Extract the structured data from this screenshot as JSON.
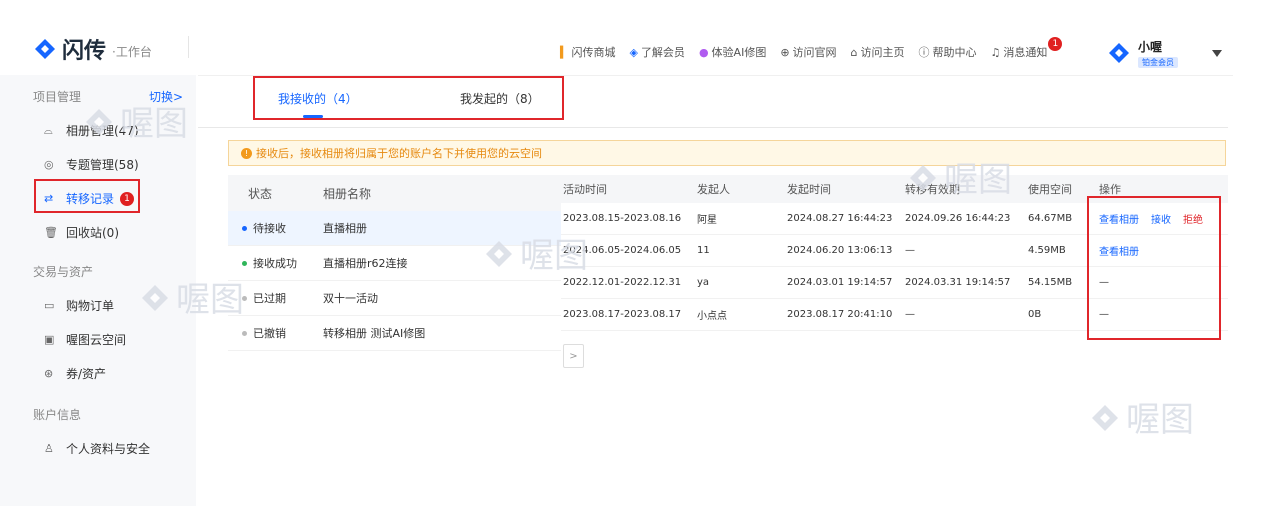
{
  "header": {
    "logo_name": "闪传",
    "logo_sub": "·工作台",
    "nav": [
      {
        "icon": "shop-icon",
        "label": "闪传商城"
      },
      {
        "icon": "vip-icon",
        "label": "了解会员"
      },
      {
        "icon": "ai-icon",
        "label": "体验AI修图"
      },
      {
        "icon": "globe-icon",
        "label": "访问官网"
      },
      {
        "icon": "home-icon",
        "label": "访问主页"
      },
      {
        "icon": "help-icon",
        "label": "帮助中心"
      },
      {
        "icon": "bell-icon",
        "label": "消息通知"
      }
    ],
    "notify_badge": "1",
    "user_name": "小喔",
    "user_tag": "铂金会员"
  },
  "sidebar": {
    "group1": "项目管理",
    "switch": "切换>",
    "items1": [
      {
        "icon": "album-icon",
        "label": "相册管理(47)"
      },
      {
        "icon": "topic-icon",
        "label": "专题管理(58)"
      },
      {
        "icon": "transfer-icon",
        "label": "转移记录",
        "badge": "1"
      },
      {
        "icon": "trash-icon",
        "label": "回收站(0)"
      }
    ],
    "group2": "交易与资产",
    "items2": [
      {
        "icon": "order-icon",
        "label": "购物订单"
      },
      {
        "icon": "cloud-icon",
        "label": "喔图云空间"
      },
      {
        "icon": "coupon-icon",
        "label": "券/资产"
      }
    ],
    "group3": "账户信息",
    "items3": [
      {
        "icon": "user-icon",
        "label": "个人资料与安全"
      }
    ]
  },
  "tabs": {
    "received": "我接收的（4）",
    "sent": "我发起的（8）"
  },
  "notice": "接收后，接收相册将归属于您的账户名下并使用您的云空间",
  "left_table": {
    "headers": [
      "状态",
      "相册名称"
    ],
    "rows": [
      {
        "status": "待接收",
        "name": "直播相册",
        "color": "#1666ff"
      },
      {
        "status": "接收成功",
        "name": "直播相册r62连接",
        "color": "#2fb55a"
      },
      {
        "status": "已过期",
        "name": "双十一活动",
        "color": "#bbbbbb"
      },
      {
        "status": "已撤销",
        "name": "转移相册 测试AI修图",
        "color": "#bbbbbb"
      }
    ]
  },
  "right_table": {
    "headers": [
      "活动时间",
      "发起人",
      "发起时间",
      "转移有效期",
      "使用空间",
      "操作"
    ],
    "rows": [
      {
        "time": "2023.08.15-2023.08.16",
        "by": "阿星",
        "at": "2024.08.27 16:44:23",
        "valid": "2024.09.26 16:44:23",
        "space": "64.67MB",
        "ops": [
          "查看相册",
          "接收"
        ],
        "reject": "拒绝"
      },
      {
        "time": "2024.06.05-2024.06.05",
        "by": "11",
        "at": "2024.06.20 13:06:13",
        "valid": "—",
        "space": "4.59MB",
        "ops": [
          "查看相册"
        ],
        "reject": ""
      },
      {
        "time": "2022.12.01-2022.12.31",
        "by": "ya",
        "at": "2024.03.01 19:14:57",
        "valid": "2024.03.31 19:14:57",
        "space": "54.15MB",
        "ops": [],
        "dash": "—",
        "reject": ""
      },
      {
        "time": "2023.08.17-2023.08.17",
        "by": "小点点",
        "at": "2023.08.17 20:41:10",
        "valid": "—",
        "space": "0B",
        "ops": [],
        "dash": "—",
        "reject": ""
      }
    ]
  },
  "pager_next": ">",
  "watermark": "喔图"
}
